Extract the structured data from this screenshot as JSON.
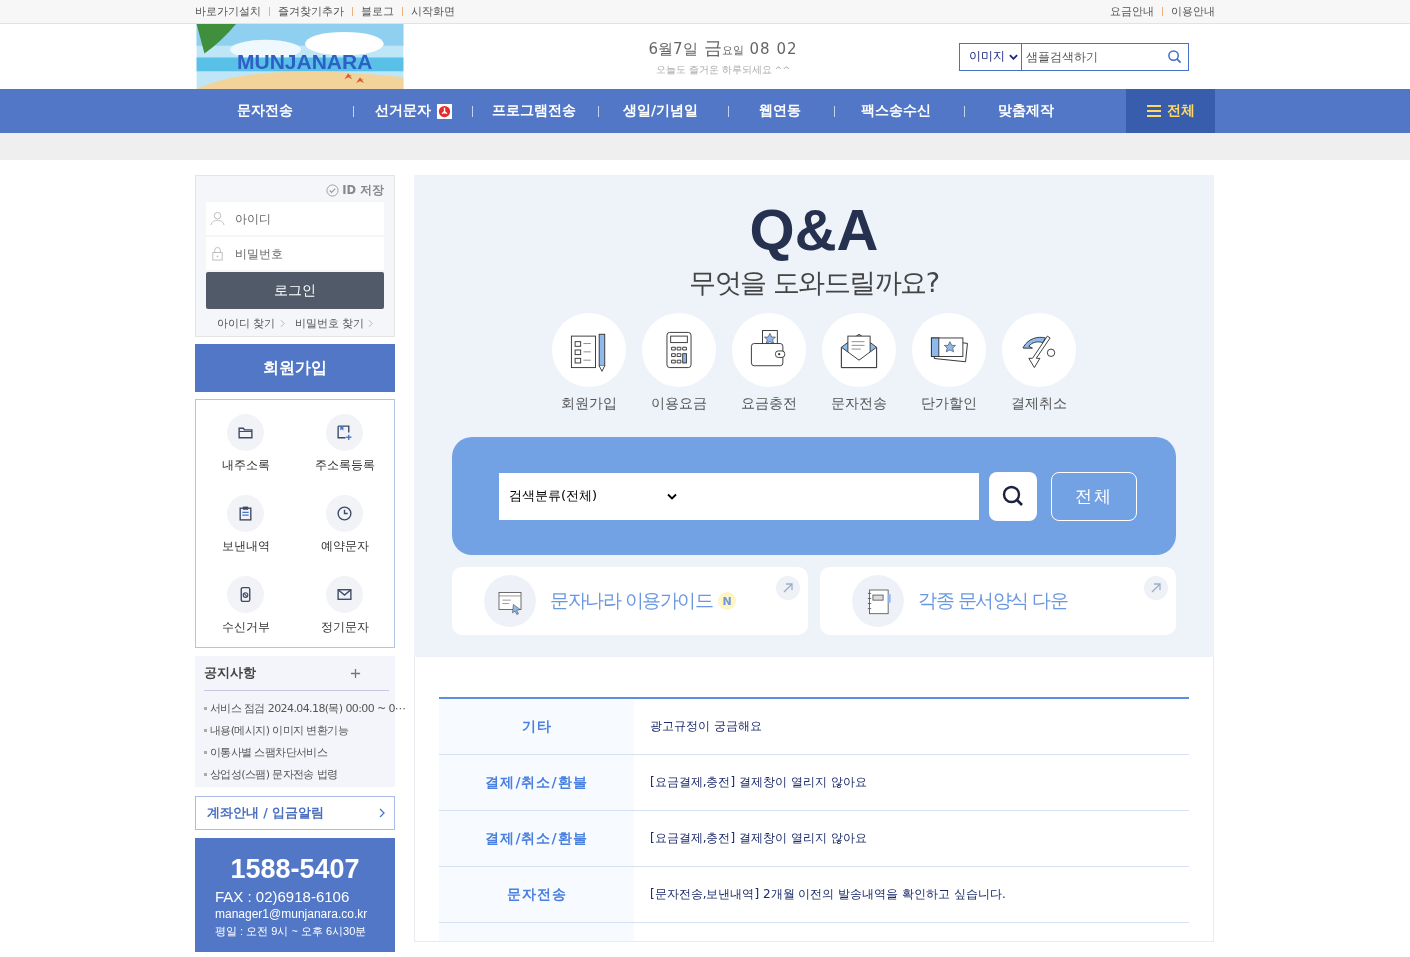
{
  "top_bar": {
    "left_links": [
      "바로가기설치",
      "즐겨찾기추가",
      "블로그",
      "시작화면"
    ],
    "right_links": [
      "요금안내",
      "이용안내"
    ]
  },
  "header": {
    "logo": {
      "text": "MUNJANARA",
      "kind": "picture"
    },
    "date": "6월7일",
    "weekday": "금",
    "weekday_suffix": "요일",
    "time": "08 02",
    "greeting": "오늘도 즐거운 하루되세요 ^^",
    "search": {
      "category": "이미지",
      "placeholder": "샘플검색하기"
    }
  },
  "nav": {
    "items": [
      {
        "label": "문자전송",
        "badge": false
      },
      {
        "label": "선거문자",
        "badge": true
      },
      {
        "label": "프로그램전송",
        "badge": false
      },
      {
        "label": "생일/기념일",
        "badge": false
      },
      {
        "label": "웹연동",
        "badge": false
      },
      {
        "label": "팩스송수신",
        "badge": false
      },
      {
        "label": "맞춤제작",
        "badge": false
      }
    ],
    "all_button": "전체"
  },
  "sidebar": {
    "login": {
      "save_id": "ID 저장",
      "save_checked": false,
      "id_placeholder": "아이디",
      "pw_placeholder": "비밀번호",
      "button": "로그인",
      "links": [
        "아이디 찾기",
        "비밀번호 찾기"
      ]
    },
    "join_button": "회원가입",
    "quick_menu": [
      {
        "label": "내주소록",
        "kind": "folder"
      },
      {
        "label": "주소록등록",
        "kind": "add"
      },
      {
        "label": "보낸내역",
        "kind": "clipboard"
      },
      {
        "label": "예약문자",
        "kind": "clock"
      },
      {
        "label": "수신거부",
        "kind": "block"
      },
      {
        "label": "정기문자",
        "kind": "mail"
      }
    ],
    "notices": {
      "title": "공지사항",
      "items": [
        "서비스 점검 2024.04.18(목) 00:00 ~ 0⋯",
        "내용(메시지) 이미지 변환기능",
        "이통사별 스팸차단서비스",
        "상업성(스팸) 문자전송 법령"
      ]
    },
    "account_link": "계좌안내 / 입금알림",
    "contact": {
      "phone": "1588-5407",
      "fax": "FAX : 02)6918-6106",
      "email": "manager1@munjanara.co.kr",
      "hours": "평일 : 오전 9시 ~ 오후 6시30분"
    }
  },
  "qa": {
    "title": "Q&A",
    "subtitle": "무엇을 도와드릴까요?",
    "categories": [
      {
        "label": "회원가입",
        "kind": "form"
      },
      {
        "label": "이용요금",
        "kind": "calculator"
      },
      {
        "label": "요금충전",
        "kind": "wallet"
      },
      {
        "label": "문자전송",
        "kind": "envelope"
      },
      {
        "label": "단가할인",
        "kind": "ticket"
      },
      {
        "label": "결제취소",
        "kind": "refund"
      }
    ],
    "search": {
      "category": "검색분류(전체)",
      "button": "전체"
    },
    "cards": [
      {
        "label": "문자나라 이용가이드",
        "badge": "N",
        "kind": "guide"
      },
      {
        "label": "각종 문서양식 다운",
        "kind": "notebook"
      }
    ],
    "rows": [
      {
        "category": "기타",
        "question": "광고규정이 궁금해요"
      },
      {
        "category": "결제/취소/환불",
        "question": "[요금결제,충전] 결제창이 열리지 않아요"
      },
      {
        "category": "결제/취소/환불",
        "question": "[요금결제,충전] 결제창이 열리지 않아요"
      },
      {
        "category": "문자전송",
        "question": "[문자전송,보낸내역] 2개월 이전의 발송내역을 확인하고 싶습니다."
      }
    ]
  }
}
